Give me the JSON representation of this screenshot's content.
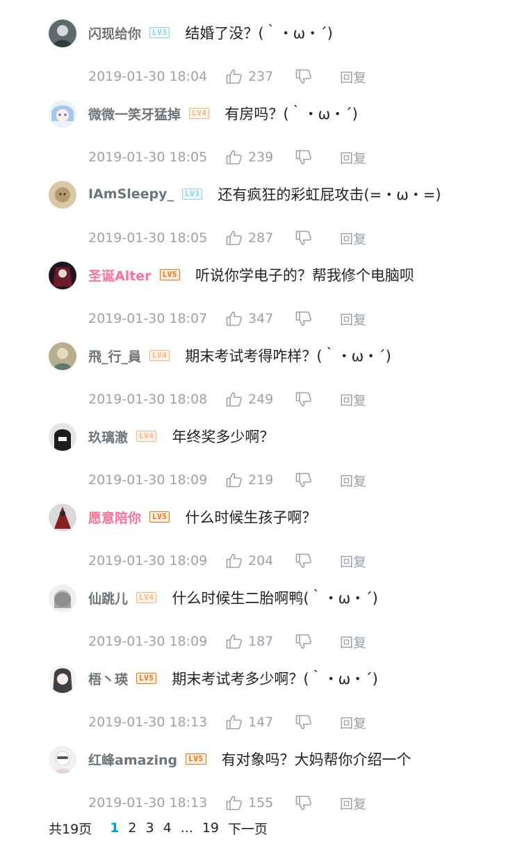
{
  "comments": [
    {
      "username": "闪现给你",
      "level": "LV3",
      "text": "结婚了没？(｀・ω・´)",
      "time": "2019-01-30 18:04",
      "likes": "237",
      "reply": "回复",
      "vip": false,
      "avatar_color": "#5b6b6d"
    },
    {
      "username": "微微一笑牙猛掉",
      "level": "LV4",
      "text": "有房吗？(｀・ω・´)",
      "time": "2019-01-30 18:05",
      "likes": "239",
      "reply": "回复",
      "vip": false,
      "avatar_color": "#a7c9e8"
    },
    {
      "username": "IAmSleepy_",
      "level": "LV3",
      "text": "还有疯狂的彩虹屁攻击(=・ω・=)",
      "time": "2019-01-30 18:05",
      "likes": "287",
      "reply": "回复",
      "vip": false,
      "avatar_color": "#c9b38f"
    },
    {
      "username": "圣诞Alter",
      "level": "LV5",
      "text": "听说你学电子的？帮我修个电脑呗",
      "time": "2019-01-30 18:07",
      "likes": "347",
      "reply": "回复",
      "vip": true,
      "avatar_color": "#3a2030"
    },
    {
      "username": "飛_行_員",
      "level": "LV4",
      "text": "期末考试考得咋样？(｀・ω・´)",
      "time": "2019-01-30 18:08",
      "likes": "249",
      "reply": "回复",
      "vip": false,
      "avatar_color": "#9a8f72"
    },
    {
      "username": "玖璃澈",
      "level": "LV4",
      "text": "年终奖多少啊？",
      "time": "2019-01-30 18:09",
      "likes": "219",
      "reply": "回复",
      "vip": false,
      "avatar_color": "#2b2b2b"
    },
    {
      "username": "愿意陪你",
      "level": "LV5",
      "text": "什么时候生孩子啊？",
      "time": "2019-01-30 18:09",
      "likes": "204",
      "reply": "回复",
      "vip": true,
      "avatar_color": "#8a1f1f"
    },
    {
      "username": "仙跳儿",
      "level": "LV4",
      "text": "什么时候生二胎啊鸭(｀・ω・´)",
      "time": "2019-01-30 18:09",
      "likes": "187",
      "reply": "回复",
      "vip": false,
      "avatar_color": "#bfbfbf"
    },
    {
      "username": "梧丶瑛",
      "level": "LV5",
      "text": "期末考试考多少啊？(｀・ω・´)",
      "time": "2019-01-30 18:13",
      "likes": "147",
      "reply": "回复",
      "vip": false,
      "avatar_color": "#3f3f46"
    },
    {
      "username": "红峰amazing",
      "level": "LV5",
      "text": "有对象吗？大妈帮你介绍一个",
      "time": "2019-01-30 18:13",
      "likes": "155",
      "reply": "回复",
      "vip": false,
      "avatar_color": "#e8e4e4"
    }
  ],
  "pagination": {
    "total": "共19页",
    "current": "1",
    "pages": [
      "2",
      "3",
      "4",
      "...",
      "19"
    ],
    "next": "下一页"
  },
  "colors": {
    "name_gray": "#6d757a",
    "name_vip": "#fb7299",
    "meta": "#99a2aa",
    "accent": "#00a1d6"
  },
  "icons": {
    "like": "thumb-up-icon",
    "dislike": "thumb-down-icon"
  }
}
